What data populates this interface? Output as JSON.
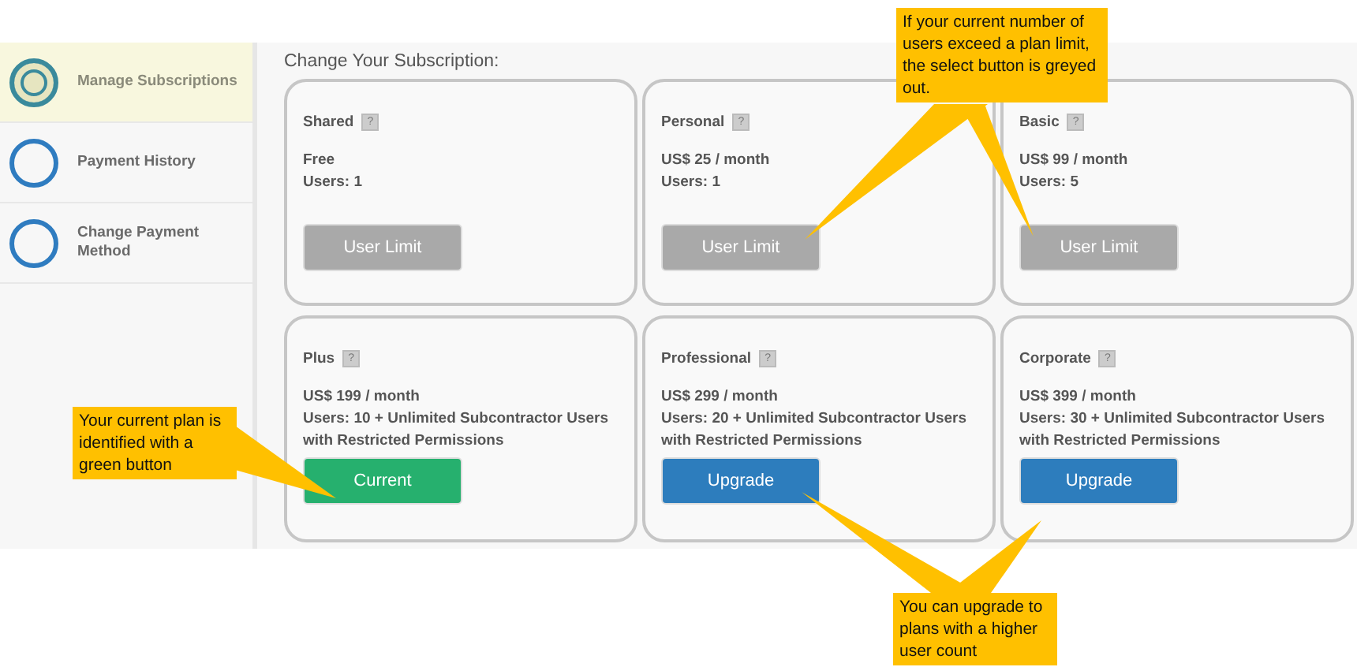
{
  "sidebar": {
    "items": [
      {
        "label": "Manage Subscriptions",
        "selected": true
      },
      {
        "label": "Payment History",
        "selected": false
      },
      {
        "label": "Change Payment Method",
        "selected": false
      }
    ]
  },
  "main": {
    "title": "Change Your Subscription:",
    "plans": [
      {
        "name": "Shared",
        "help": "?",
        "price": "Free",
        "users": "Users: 1",
        "button": {
          "label": "User Limit",
          "kind": "disabled"
        }
      },
      {
        "name": "Personal",
        "help": "?",
        "price": "US$ 25 / month",
        "users": "Users: 1",
        "button": {
          "label": "User Limit",
          "kind": "disabled"
        }
      },
      {
        "name": "Basic",
        "help": "?",
        "price": "US$ 99 / month",
        "users": "Users: 5",
        "button": {
          "label": "User Limit",
          "kind": "disabled"
        }
      },
      {
        "name": "Plus",
        "help": "?",
        "price": "US$ 199 / month",
        "users": "Users: 10 + Unlimited Subcontractor Users with Restricted Permissions",
        "button": {
          "label": "Current",
          "kind": "current"
        }
      },
      {
        "name": "Professional",
        "help": "?",
        "price": "US$ 299 / month",
        "users": "Users: 20 + Unlimited Subcontractor Users with Restricted Permissions",
        "button": {
          "label": "Upgrade",
          "kind": "upgrade"
        }
      },
      {
        "name": "Corporate",
        "help": "?",
        "price": "US$ 399 / month",
        "users": "Users: 30 + Unlimited Subcontractor Users with Restricted Permissions",
        "button": {
          "label": "Upgrade",
          "kind": "upgrade"
        }
      }
    ]
  },
  "callouts": [
    {
      "text": "If your current number of users exceed a plan limit, the select button is greyed out."
    },
    {
      "text": "Your current plan is identified with a green button"
    },
    {
      "text": "You can upgrade to plans with a higher user count"
    }
  ]
}
